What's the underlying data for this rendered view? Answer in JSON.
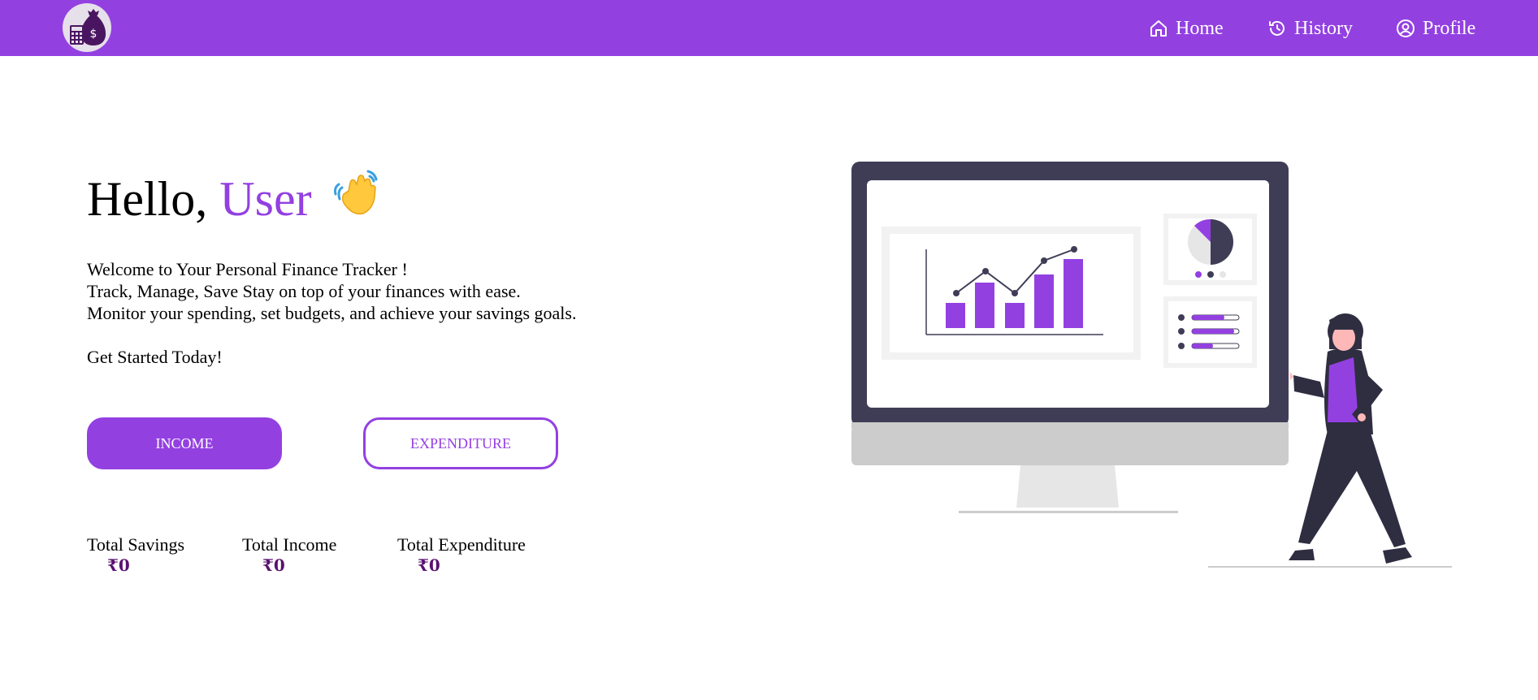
{
  "nav": {
    "logo_icon": "finance-money-bag-calculator-icon",
    "items": [
      {
        "label": "Home",
        "icon": "home-icon"
      },
      {
        "label": "History",
        "icon": "history-icon"
      },
      {
        "label": "Profile",
        "icon": "profile-icon"
      }
    ]
  },
  "hero": {
    "greeting": "Hello,",
    "username": "User",
    "wave_icon": "waving-hand-icon",
    "intro_lines": [
      "Welcome to Your Personal Finance Tracker !",
      "Track, Manage, Save Stay on top of your finances with ease.",
      "Monitor your spending, set budgets, and achieve your savings goals."
    ],
    "cta": "Get Started Today!"
  },
  "buttons": {
    "income": "INCOME",
    "expenditure": "EXPENDITURE"
  },
  "stats": [
    {
      "label": "Total Savings",
      "value": "₹0"
    },
    {
      "label": "Total Income",
      "value": "₹0"
    },
    {
      "label": "Total Expenditure",
      "value": "₹0"
    }
  ],
  "colors": {
    "primary": "#9340e1",
    "amount": "#5a1070",
    "dark": "#3f3d56"
  }
}
